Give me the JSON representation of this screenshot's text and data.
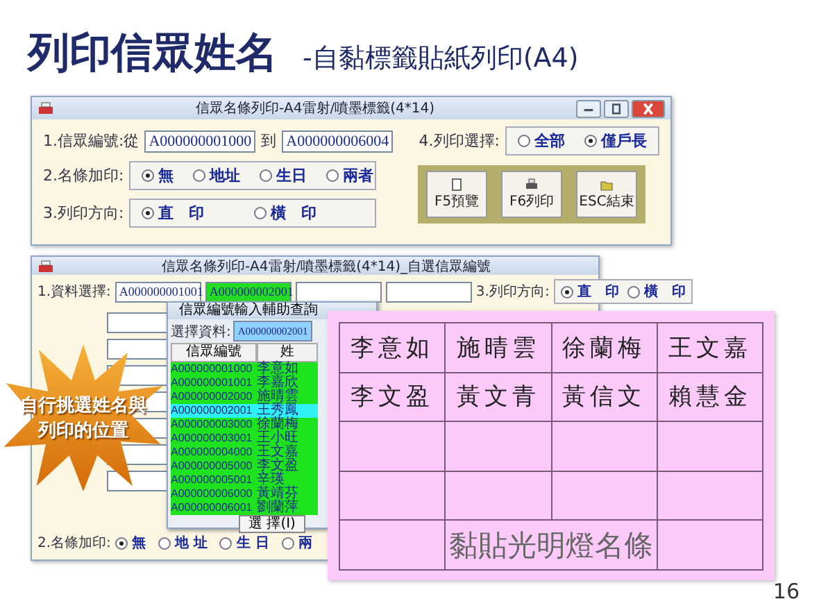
{
  "slide": {
    "title": "列印信眾姓名",
    "subtitle": "-自黏標籤貼紙列印(A4)",
    "page_number": "16"
  },
  "main_window": {
    "title": "信眾名條列印-A4雷射/噴墨標籤(4*14)",
    "range": {
      "label": "1.信眾編號:從",
      "from": "A000000001000",
      "to_label": "到",
      "to": "A000000006004"
    },
    "print_choice": {
      "label": "4.列印選擇:",
      "options": [
        {
          "label": "全部",
          "selected": false
        },
        {
          "label": "僅戶長",
          "selected": true
        }
      ]
    },
    "extra_print": {
      "label": "2.名條加印:",
      "options": [
        {
          "label": "無",
          "selected": true
        },
        {
          "label": "地址",
          "selected": false
        },
        {
          "label": "生日",
          "selected": false
        },
        {
          "label": "兩者",
          "selected": false
        }
      ]
    },
    "direction": {
      "label": "3.列印方向:",
      "options": [
        {
          "label": "直　印",
          "selected": true
        },
        {
          "label": "橫　印",
          "selected": false
        }
      ]
    },
    "buttons": [
      {
        "label": "F5預覽"
      },
      {
        "label": "F6列印"
      },
      {
        "label": "ESC結束"
      }
    ]
  },
  "custom_window": {
    "title": "信眾名條列印-A4雷射/噴墨標籤(4*14)_自選信眾編號",
    "data_label": "1.資料選擇:",
    "fields": [
      {
        "value": "A000000001001",
        "selected": false
      },
      {
        "value": "A000000002001",
        "selected": true
      }
    ],
    "direction": {
      "label": "3.列印方向:",
      "options": [
        {
          "label": "直　印",
          "selected": true
        },
        {
          "label": "橫　印",
          "selected": false
        }
      ]
    },
    "extra_print": {
      "label": "2.名條加印:",
      "options": [
        {
          "label": "無",
          "selected": true
        },
        {
          "label": "地 址",
          "selected": false
        },
        {
          "label": "生 日",
          "selected": false
        },
        {
          "label": "兩",
          "selected": false
        }
      ]
    }
  },
  "lookup_dialog": {
    "title": "信眾編號輸入輔助查詢",
    "select_label": "選擇資料:",
    "select_value": "A000000002001",
    "columns": [
      "信眾編號",
      "姓"
    ],
    "rows": [
      {
        "id": "A000000001000",
        "name": "李意如",
        "selected": false
      },
      {
        "id": "A000000001001",
        "name": "李嘉欣",
        "selected": false
      },
      {
        "id": "A000000002000",
        "name": "施晴雲",
        "selected": false
      },
      {
        "id": "A000000002001",
        "name": "王秀鳳",
        "selected": true
      },
      {
        "id": "A000000003000",
        "name": "徐蘭梅",
        "selected": false
      },
      {
        "id": "A000000003001",
        "name": "王小旺",
        "selected": false
      },
      {
        "id": "A000000004000",
        "name": "王文嘉",
        "selected": false
      },
      {
        "id": "A000000005000",
        "name": "李文盈",
        "selected": false
      },
      {
        "id": "A000000005001",
        "name": "辛瑛",
        "selected": false
      },
      {
        "id": "A000000006000",
        "name": "黃靖芬",
        "selected": false
      },
      {
        "id": "A000000006001",
        "name": "劉蘭萍",
        "selected": false
      }
    ],
    "button": "選 擇(I)"
  },
  "callout": {
    "lines": [
      "自行挑選姓名與",
      "列印的位置"
    ]
  },
  "label_sheet": {
    "rows": [
      [
        "李意如",
        "施晴雲",
        "徐蘭梅",
        "王文嘉"
      ],
      [
        "李文盈",
        "黃文青",
        "黃信文",
        "賴慧金"
      ]
    ],
    "caption": "黏貼光明燈名條"
  }
}
